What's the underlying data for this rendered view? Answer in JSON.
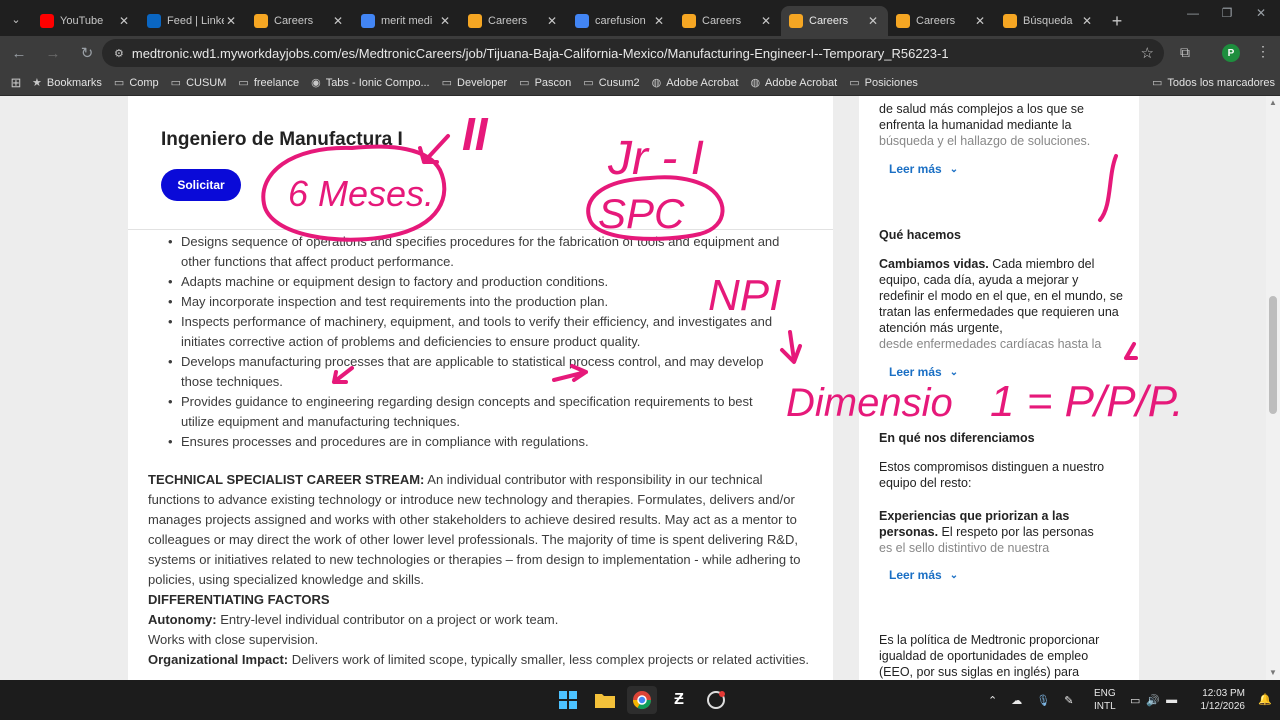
{
  "browser": {
    "tabs": [
      {
        "label": "YouTube",
        "icon": "youtube-icon",
        "color": "#ff0000"
      },
      {
        "label": "Feed | Linke",
        "icon": "linkedin-icon",
        "color": "#0a66c2"
      },
      {
        "label": "Careers",
        "icon": "workday-icon",
        "color": "#f5a623"
      },
      {
        "label": "merit medi",
        "icon": "google-icon",
        "color": "#4285f4"
      },
      {
        "label": "Careers",
        "icon": "workday-icon",
        "color": "#f5a623"
      },
      {
        "label": "carefusion",
        "icon": "google-icon",
        "color": "#4285f4"
      },
      {
        "label": "Careers",
        "icon": "workday-icon",
        "color": "#f5a623"
      },
      {
        "label": "Careers",
        "icon": "workday-icon",
        "color": "#f5a623"
      },
      {
        "label": "Careers",
        "icon": "workday-icon",
        "color": "#f5a623"
      },
      {
        "label": "Búsqueda",
        "icon": "workday-icon",
        "color": "#f5a623"
      }
    ],
    "active_tab_index": 7,
    "url": "medtronic.wd1.myworkdayjobs.com/es/MedtronicCareers/job/Tijuana-Baja-California-Mexico/Manufacturing-Engineer-I--Temporary_R56223-1",
    "profile_initial": "P",
    "bookmarks": [
      {
        "label": "Bookmarks",
        "icon": "star-icon"
      },
      {
        "label": "Comp",
        "icon": "folder-icon"
      },
      {
        "label": "CUSUM",
        "icon": "folder-icon"
      },
      {
        "label": "freelance",
        "icon": "folder-icon"
      },
      {
        "label": "Tabs - Ionic Compo...",
        "icon": "ionic-icon"
      },
      {
        "label": "Developer",
        "icon": "folder-icon"
      },
      {
        "label": "Pascon",
        "icon": "folder-icon"
      },
      {
        "label": "Cusum2",
        "icon": "folder-icon"
      },
      {
        "label": "Adobe Acrobat",
        "icon": "globe-icon"
      },
      {
        "label": "Adobe Acrobat",
        "icon": "globe-icon"
      },
      {
        "label": "Posiciones",
        "icon": "folder-icon"
      }
    ],
    "all_bookmarks_label": "Todos los marcadores"
  },
  "job": {
    "title": "Ingeniero de Manufactura I",
    "apply_label": "Solicitar",
    "responsibilities": [
      "Designs sequence of operations and specifies procedures for the fabrication of tools and equipment and other functions that affect product performance.",
      "Adapts machine or equipment design to factory and production conditions.",
      "May incorporate inspection and test requirements into the production plan.",
      "Inspects performance of machinery, equipment, and tools to verify their efficiency, and investigates and initiates corrective action of problems and deficiencies to ensure product quality.",
      "Develops manufacturing processes that are applicable to statistical process control, and may develop those techniques.",
      "Provides guidance to engineering regarding design concepts and specification requirements to best utilize equipment and manufacturing techniques.",
      "Ensures processes and procedures are in compliance with regulations."
    ],
    "stream_label": "TECHNICAL SPECIALIST CAREER STREAM:",
    "stream_text": " An individual contributor with responsibility in our technical functions to advance existing technology or introduce new technology and therapies.  Formulates, delivers and/or manages projects assigned and works with other stakeholders to achieve desired results.  May act as a mentor to colleagues or may direct the work of other lower level professionals.  The majority of time is spent delivering R&D, systems or initiatives related to new technologies or therapies – from design to implementation - while adhering to policies, using specialized knowledge and skills.",
    "diff_heading": "DIFFERENTIATING FACTORS",
    "autonomy_label": "Autonomy:",
    "autonomy_text": " Entry-level individual contributor on a project or work team.",
    "supervision_text": "Works with close supervision.",
    "org_label": "Organizational Impact:",
    "org_text": " Delivers work of limited scope, typically smaller, less complex projects or related activities."
  },
  "sidebar": {
    "intro_text": "de salud más complejos a los que se enfrenta la humanidad mediante la",
    "intro_faded": "búsqueda y el hallazgo de soluciones.",
    "read_more": "Leer más",
    "what_heading": "Qué hacemos",
    "what_bold": "Cambiamos vidas.",
    "what_text": " Cada miembro del equipo, cada día, ayuda a mejorar y redefinir el modo en el que, en el mundo, se tratan las enfermedades que requieren una atención más urgente,",
    "what_faded": "desde enfermedades cardíacas hasta la",
    "diff_heading": "En qué nos diferenciamos",
    "diff_text": "Estos compromisos distinguen a nuestro equipo del resto:",
    "people_bold": "Experiencias que priorizan a las personas.",
    "people_text": " El respeto por las personas",
    "people_faded": "es el sello distintivo de nuestra",
    "eeo_text": "Es la política de Medtronic proporcionar igualdad de oportunidades de empleo (EEO, por sus siglas en inglés) para"
  },
  "annotations": {
    "color": "#e6197a",
    "roman_two": "II",
    "months": "6 Meses.",
    "level": "Jr - I",
    "spc": "SPC",
    "npi": "NPI",
    "dimension": "Dimensio",
    "equation": "1 = P/P/P."
  },
  "taskbar": {
    "lang_top": "ENG",
    "lang_bottom": "INTL",
    "time": "12:03 PM",
    "date": "1/12/2026"
  }
}
